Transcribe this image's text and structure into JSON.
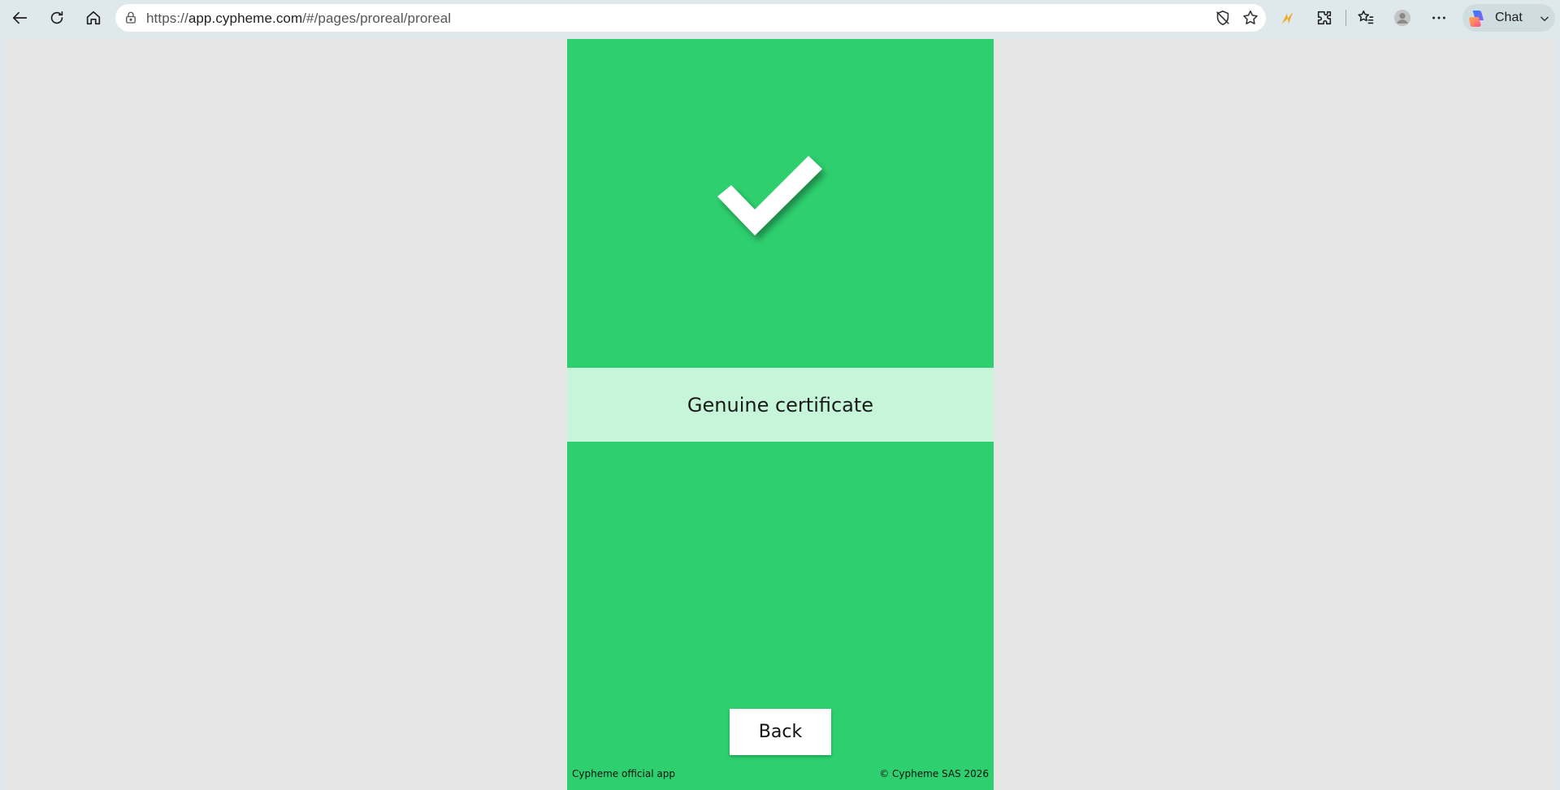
{
  "browser": {
    "url_scheme": "https://",
    "url_host": "app.cypheme.com",
    "url_path": "/#/pages/proreal/proreal",
    "chat_label": "Chat",
    "icons": [
      "back-arrow-icon",
      "refresh-icon",
      "home-icon",
      "lock-icon",
      "tracking-prevention-icon",
      "favorite-star-icon",
      "bolt-extension-icon",
      "extensions-puzzle-icon",
      "favorites-icon",
      "profile-avatar-icon",
      "more-dots-icon",
      "copilot-icon",
      "chevron-down-icon"
    ]
  },
  "app": {
    "background": "#2ecf6f",
    "banner_background": "#c6f5d9",
    "status_text": "Genuine certificate",
    "back_label": "Back",
    "footer_left": "Cypheme official app",
    "footer_right": "© Cypheme SAS 2026"
  }
}
